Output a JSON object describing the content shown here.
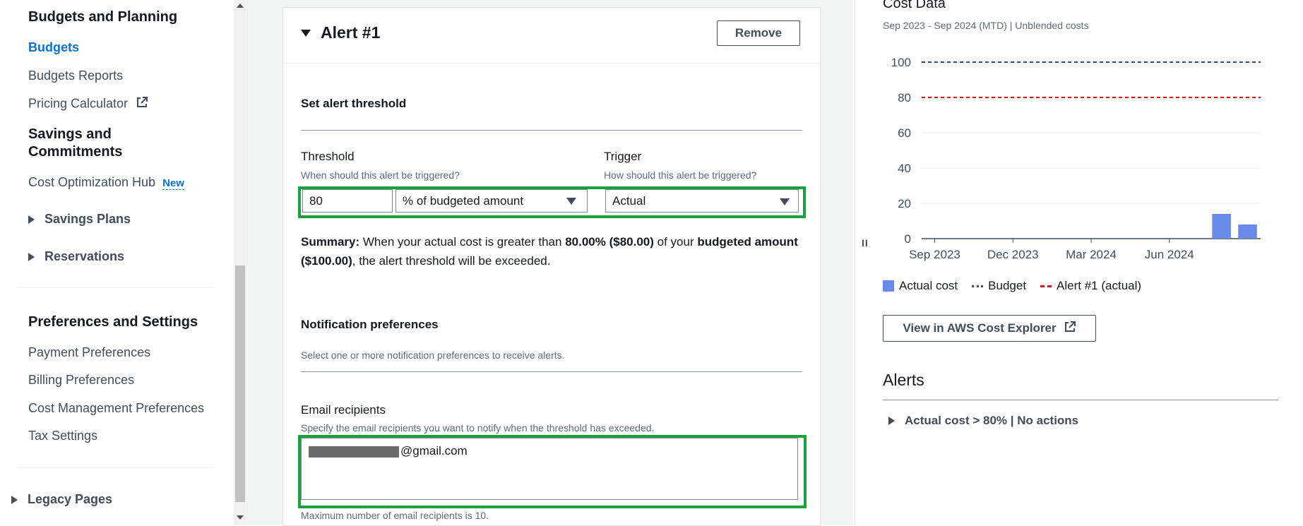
{
  "sidebar": {
    "budgets_planning": "Budgets and Planning",
    "budgets": "Budgets",
    "budgets_reports": "Budgets Reports",
    "pricing_calculator": "Pricing Calculator",
    "savings_line1": "Savings and",
    "savings_line2": "Commitments",
    "cost_opt_hub": "Cost Optimization Hub",
    "new_badge": "New",
    "savings_plans": "Savings Plans",
    "reservations": "Reservations",
    "preferences": "Preferences and Settings",
    "payment_prefs": "Payment Preferences",
    "billing_prefs": "Billing Preferences",
    "cost_mgmt_prefs": "Cost Management Preferences",
    "tax_settings": "Tax Settings",
    "legacy_pages": "Legacy Pages"
  },
  "alert": {
    "title": "Alert #1",
    "remove": "Remove",
    "set_threshold": "Set alert threshold",
    "threshold_label": "Threshold",
    "threshold_desc": "When should this alert be triggered?",
    "threshold_value": "80",
    "threshold_unit": "% of budgeted amount",
    "trigger_label": "Trigger",
    "trigger_desc": "How should this alert be triggered?",
    "trigger_value": "Actual",
    "summary_label": "Summary:",
    "summary_t1": "When your actual cost is greater than",
    "summary_pct": "80.00% ($80.00)",
    "summary_t2": "of your",
    "summary_budget": "budgeted amount ($100.00)",
    "summary_t3": ", the alert threshold will be exceeded.",
    "notif_title": "Notification preferences",
    "notif_desc": "Select one or more notification preferences to receive alerts.",
    "email_label": "Email recipients",
    "email_desc": "Specify the email recipients you want to notify when the threshold has exceeded.",
    "email_value": "@gmail.com",
    "max_note": "Maximum number of email recipients is 10."
  },
  "right": {
    "title": "Cost Data",
    "subtitle": "Sep 2023 - Sep 2024 (MTD) | Unblended costs",
    "legend_actual": "Actual cost",
    "legend_budget": "Budget",
    "legend_alert": "Alert #1 (actual)",
    "view_btn": "View in AWS Cost Explorer",
    "alerts_title": "Alerts",
    "alert_row": "Actual cost > 80% | No actions",
    "splitter": "II"
  },
  "colors": {
    "accent": "#0972d3",
    "highlight": "#1aa13b",
    "bar": "#688ae8",
    "alert_line": "#d91515",
    "budget_line": "#414d5c"
  },
  "chart_data": {
    "type": "bar",
    "y_ticks": [
      "100",
      "80",
      "60",
      "40",
      "20",
      "0"
    ],
    "x_ticks": [
      "Sep 2023",
      "Dec 2023",
      "Mar 2024",
      "Jun 2024"
    ],
    "ylim": [
      0,
      100
    ],
    "bars": [
      {
        "month": "Aug 2024",
        "value": 14
      },
      {
        "month": "Sep 2024",
        "value": 8
      }
    ],
    "budget": 100,
    "alert_threshold": 80
  }
}
